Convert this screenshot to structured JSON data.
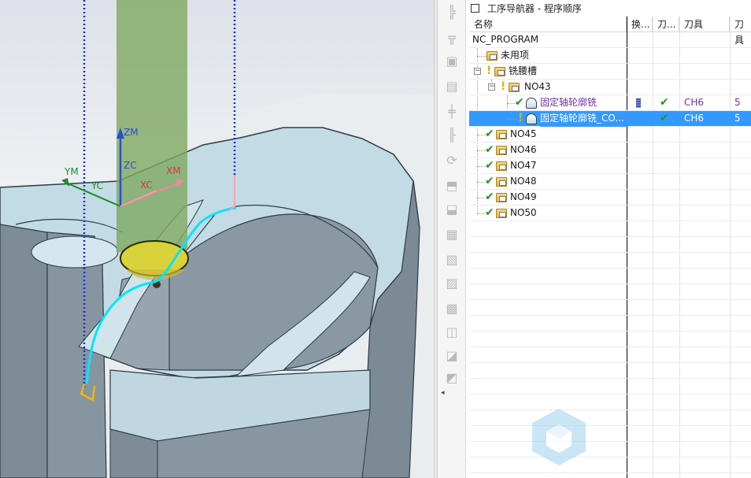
{
  "navigator": {
    "title": "工序导航器 - 程序顺序",
    "columns": [
      "名称",
      "换...",
      "刀...",
      "刀具",
      "刀具"
    ],
    "rows": [
      {
        "name": "NC_PROGRAM",
        "status": "",
        "tool": "",
        "tool_no": ""
      },
      {
        "name": "未用项",
        "status": "",
        "tool": "",
        "tool_no": ""
      },
      {
        "name": "铣腰槽",
        "status": "warning",
        "tool": "",
        "tool_no": ""
      },
      {
        "name": "NO43",
        "status": "warning",
        "tool": "",
        "tool_no": ""
      },
      {
        "name": "固定轴轮廓铣",
        "status": "check",
        "tool": "CH6",
        "tool_no": "5"
      },
      {
        "name": "固定轴轮廓铣_CO...",
        "status": "warning",
        "tool": "CH6",
        "tool_no": "5"
      },
      {
        "name": "NO45",
        "status": "check",
        "tool": "",
        "tool_no": ""
      },
      {
        "name": "NO46",
        "status": "check",
        "tool": "",
        "tool_no": ""
      },
      {
        "name": "NO47",
        "status": "check",
        "tool": "",
        "tool_no": ""
      },
      {
        "name": "NO48",
        "status": "check",
        "tool": "",
        "tool_no": ""
      },
      {
        "name": "NO49",
        "status": "check",
        "tool": "",
        "tool_no": ""
      },
      {
        "name": "NO50",
        "status": "check",
        "tool": "",
        "tool_no": ""
      }
    ],
    "selected_row": "固定轴轮廓铣_CO...",
    "tool_color": "#7030a0",
    "selected_color": "#3399ff"
  },
  "viewport": {
    "axis_labels": {
      "zm": "ZM",
      "zc": "ZC",
      "ym": "YM",
      "yc": "YC",
      "xm": "XM",
      "xc": "XC"
    },
    "toolpath_color": "#00e5ff",
    "tool_color": "#7aa35a",
    "part_color": "#7a8a96"
  },
  "toolbar_icons": [
    "operation-icon",
    "tool-icon",
    "copy-icon",
    "paste-icon",
    "geometry-icon",
    "method-icon",
    "program-icon",
    "undo-icon",
    "generate-icon",
    "verify-icon",
    "postprocess-icon",
    "list-icon",
    "tree-icon",
    "shop-doc-icon",
    "output-icon",
    "simulate-icon",
    "feed-icon",
    "save-icon"
  ]
}
